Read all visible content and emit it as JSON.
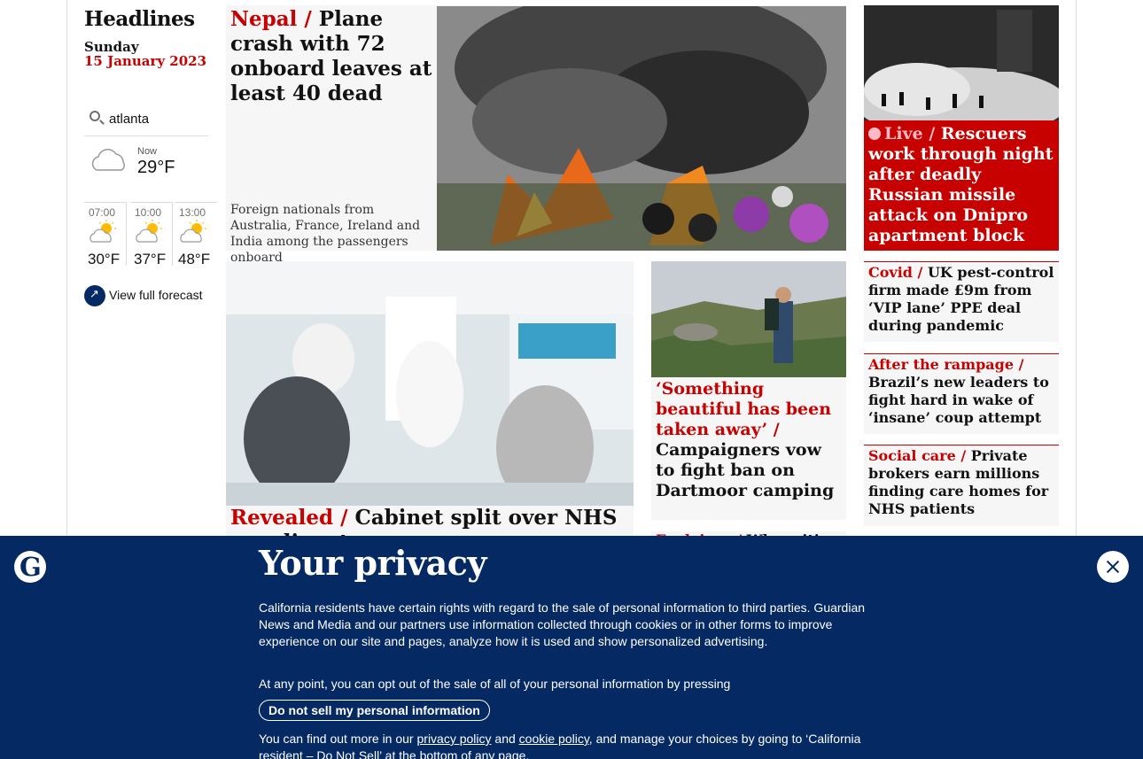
{
  "sidebar": {
    "heading": "Headlines",
    "day": "Sunday",
    "date": "15 January 2023",
    "weather": {
      "location": "atlanta",
      "now_label": "Now",
      "now_temp": "29°F",
      "now_icon": "partly-cloudy-icon",
      "forecast": [
        {
          "time": "07:00",
          "temp": "30°F",
          "icon": "sun-cloud-icon"
        },
        {
          "time": "10:00",
          "temp": "37°F",
          "icon": "sun-cloud-icon"
        },
        {
          "time": "13:00",
          "temp": "48°F",
          "icon": "sun-cloud-icon"
        }
      ],
      "full_forecast": "View full forecast"
    }
  },
  "stories": {
    "nepal": {
      "kicker": "Nepal / ",
      "headline": "Plane crash with 72 onboard leaves at least 40 dead",
      "standfirst": "Foreign nationals from Australia, France, Ireland and India among the passengers onboard"
    },
    "ukraine": {
      "kicker": "Live / ",
      "headline": "Rescuers work through night after deadly Russian missile attack on Dnipro apartment block"
    },
    "nhs": {
      "kicker": "Revealed  / ",
      "headline": "Cabinet split over NHS pay dispute"
    },
    "dartmoor": {
      "kicker": "‘Something beautiful has been taken away’ / ",
      "headline": "Campaigners vow to fight ban on Dartmoor camping"
    },
    "covid": {
      "kicker": "Covid / ",
      "headline": "UK pest-control firm made £9m from ‘VIP lane’ PPE deal during pandemic"
    },
    "brazil": {
      "kicker": "After the rampage / ",
      "headline": "Brazil’s new leaders to fight hard in wake of ‘insane’ coup attempt"
    },
    "social_care": {
      "kicker": "Social care / ",
      "headline": "Private brokers earn millions finding care homes for NHS patients"
    },
    "partial": {
      "kicker": "Explainer / ",
      "headline": "Why critics"
    }
  },
  "privacy": {
    "title": "Your privacy",
    "p1": "California residents have certain rights with regard to the sale of personal information to third parties. Guardian News and Media and our partners use information collected through cookies or in other forms to improve experience on our site and pages, analyze how it is used and show personalized advertising.",
    "p2": "At any point, you can opt out of the sale of all of your personal information by pressing",
    "button": "Do not sell my personal information",
    "p3_a": "You can find out more in our ",
    "privacy_link": "privacy policy",
    "p3_b": " and ",
    "cookie_link": "cookie policy",
    "p3_c": ", and manage your choices by going to ‘California resident – Do Not Sell’ at the bottom of any page."
  },
  "colors": {
    "brand_blue": "#052962",
    "news_red": "#c70000",
    "card_grey": "#f6f6f6"
  }
}
